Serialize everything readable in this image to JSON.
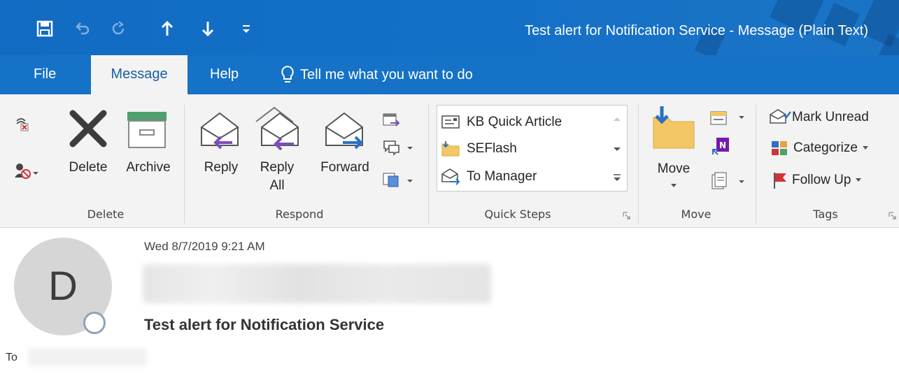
{
  "window": {
    "title": "Test alert for Notification Service  -  Message (Plain Text)",
    "accent": "#1570c6"
  },
  "quick_access": {
    "save": "save-icon",
    "undo": "undo-icon",
    "redo": "redo-icon",
    "up": "arrow-up-icon",
    "down": "arrow-down-icon",
    "customize": "customize-icon"
  },
  "tabs": [
    {
      "label": "File"
    },
    {
      "label": "Message",
      "active": true
    },
    {
      "label": "Help"
    }
  ],
  "tell_me": {
    "label": "Tell me what you want to do"
  },
  "ribbon": {
    "delete_group": {
      "label": "Delete",
      "delete": "Delete",
      "archive": "Archive"
    },
    "respond_group": {
      "label": "Respond",
      "reply": "Reply",
      "reply_all_1": "Reply",
      "reply_all_2": "All",
      "forward": "Forward"
    },
    "quick_steps_group": {
      "label": "Quick Steps",
      "items": [
        "KB Quick Article",
        "SEFlash",
        "To Manager"
      ]
    },
    "move_group": {
      "label": "Move",
      "move": "Move"
    },
    "tags_group": {
      "label": "Tags",
      "mark_unread": "Mark Unread",
      "categorize": "Categorize",
      "follow_up": "Follow Up"
    }
  },
  "message": {
    "avatar_letter": "D",
    "date": "Wed 8/7/2019 9:21 AM",
    "subject": "Test alert for Notification Service",
    "to_label": "To"
  }
}
